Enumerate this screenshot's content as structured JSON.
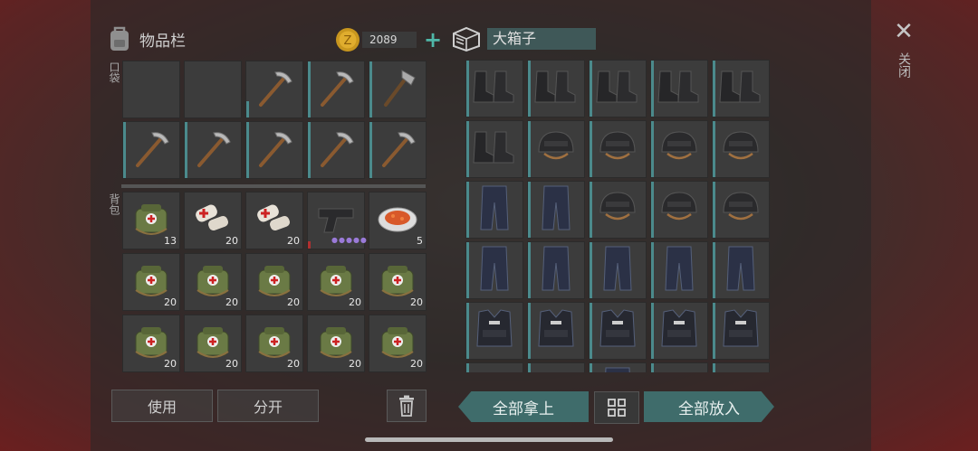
{
  "inventory": {
    "title": "物品栏",
    "pocket_label": "口袋",
    "backpack_label": "背包"
  },
  "currency": {
    "amount": "2089",
    "add_symbol": "+"
  },
  "box": {
    "title": "大箱子"
  },
  "close": {
    "symbol": "✕",
    "label": "关闭"
  },
  "pocket_items": [
    {
      "icon": "empty",
      "count": ""
    },
    {
      "icon": "empty",
      "count": ""
    },
    {
      "icon": "pickaxe-icon",
      "count": ""
    },
    {
      "icon": "pickaxe-icon",
      "count": ""
    },
    {
      "icon": "hatchet-icon",
      "count": ""
    },
    {
      "icon": "pickaxe-icon",
      "count": ""
    },
    {
      "icon": "pickaxe-icon",
      "count": ""
    },
    {
      "icon": "pickaxe-icon",
      "count": ""
    },
    {
      "icon": "pickaxe-icon",
      "count": ""
    },
    {
      "icon": "pickaxe-icon",
      "count": ""
    }
  ],
  "backpack_items": [
    {
      "icon": "medkit-bag-icon",
      "count": "13"
    },
    {
      "icon": "bandage-icon",
      "count": "20"
    },
    {
      "icon": "bandage-icon",
      "count": "20"
    },
    {
      "icon": "pistol-icon",
      "count": ""
    },
    {
      "icon": "food-plate-icon",
      "count": "5"
    },
    {
      "icon": "medkit-bag-icon",
      "count": "20"
    },
    {
      "icon": "medkit-bag-icon",
      "count": "20"
    },
    {
      "icon": "medkit-bag-icon",
      "count": "20"
    },
    {
      "icon": "medkit-bag-icon",
      "count": "20"
    },
    {
      "icon": "medkit-bag-icon",
      "count": "20"
    },
    {
      "icon": "medkit-bag-icon",
      "count": "20"
    },
    {
      "icon": "medkit-bag-icon",
      "count": "20"
    },
    {
      "icon": "medkit-bag-icon",
      "count": "20"
    },
    {
      "icon": "medkit-bag-icon",
      "count": "20"
    },
    {
      "icon": "medkit-bag-icon",
      "count": "20"
    }
  ],
  "box_items": [
    "boots-icon",
    "boots-icon",
    "boots-icon",
    "boots-icon",
    "boots-icon",
    "boots-icon",
    "helmet-icon",
    "helmet-icon",
    "helmet-icon",
    "helmet-icon",
    "pants-icon",
    "pants-icon",
    "helmet-icon",
    "helmet-icon",
    "helmet-icon",
    "pants-icon",
    "pants-icon",
    "pants-icon",
    "pants-icon",
    "pants-icon",
    "vest-icon",
    "vest-icon",
    "vest-icon",
    "vest-icon",
    "vest-icon",
    "helmet-icon",
    "helmet-icon",
    "pants-icon",
    "helmet-icon",
    "helmet-icon"
  ],
  "buttons": {
    "use": "使用",
    "split": "分开",
    "take_all": "全部拿上",
    "put_all": "全部放入"
  },
  "colors": {
    "teal": "#3f6c6b",
    "slot": "#3c3c3c",
    "accent_bar": "#4b8a8c"
  }
}
